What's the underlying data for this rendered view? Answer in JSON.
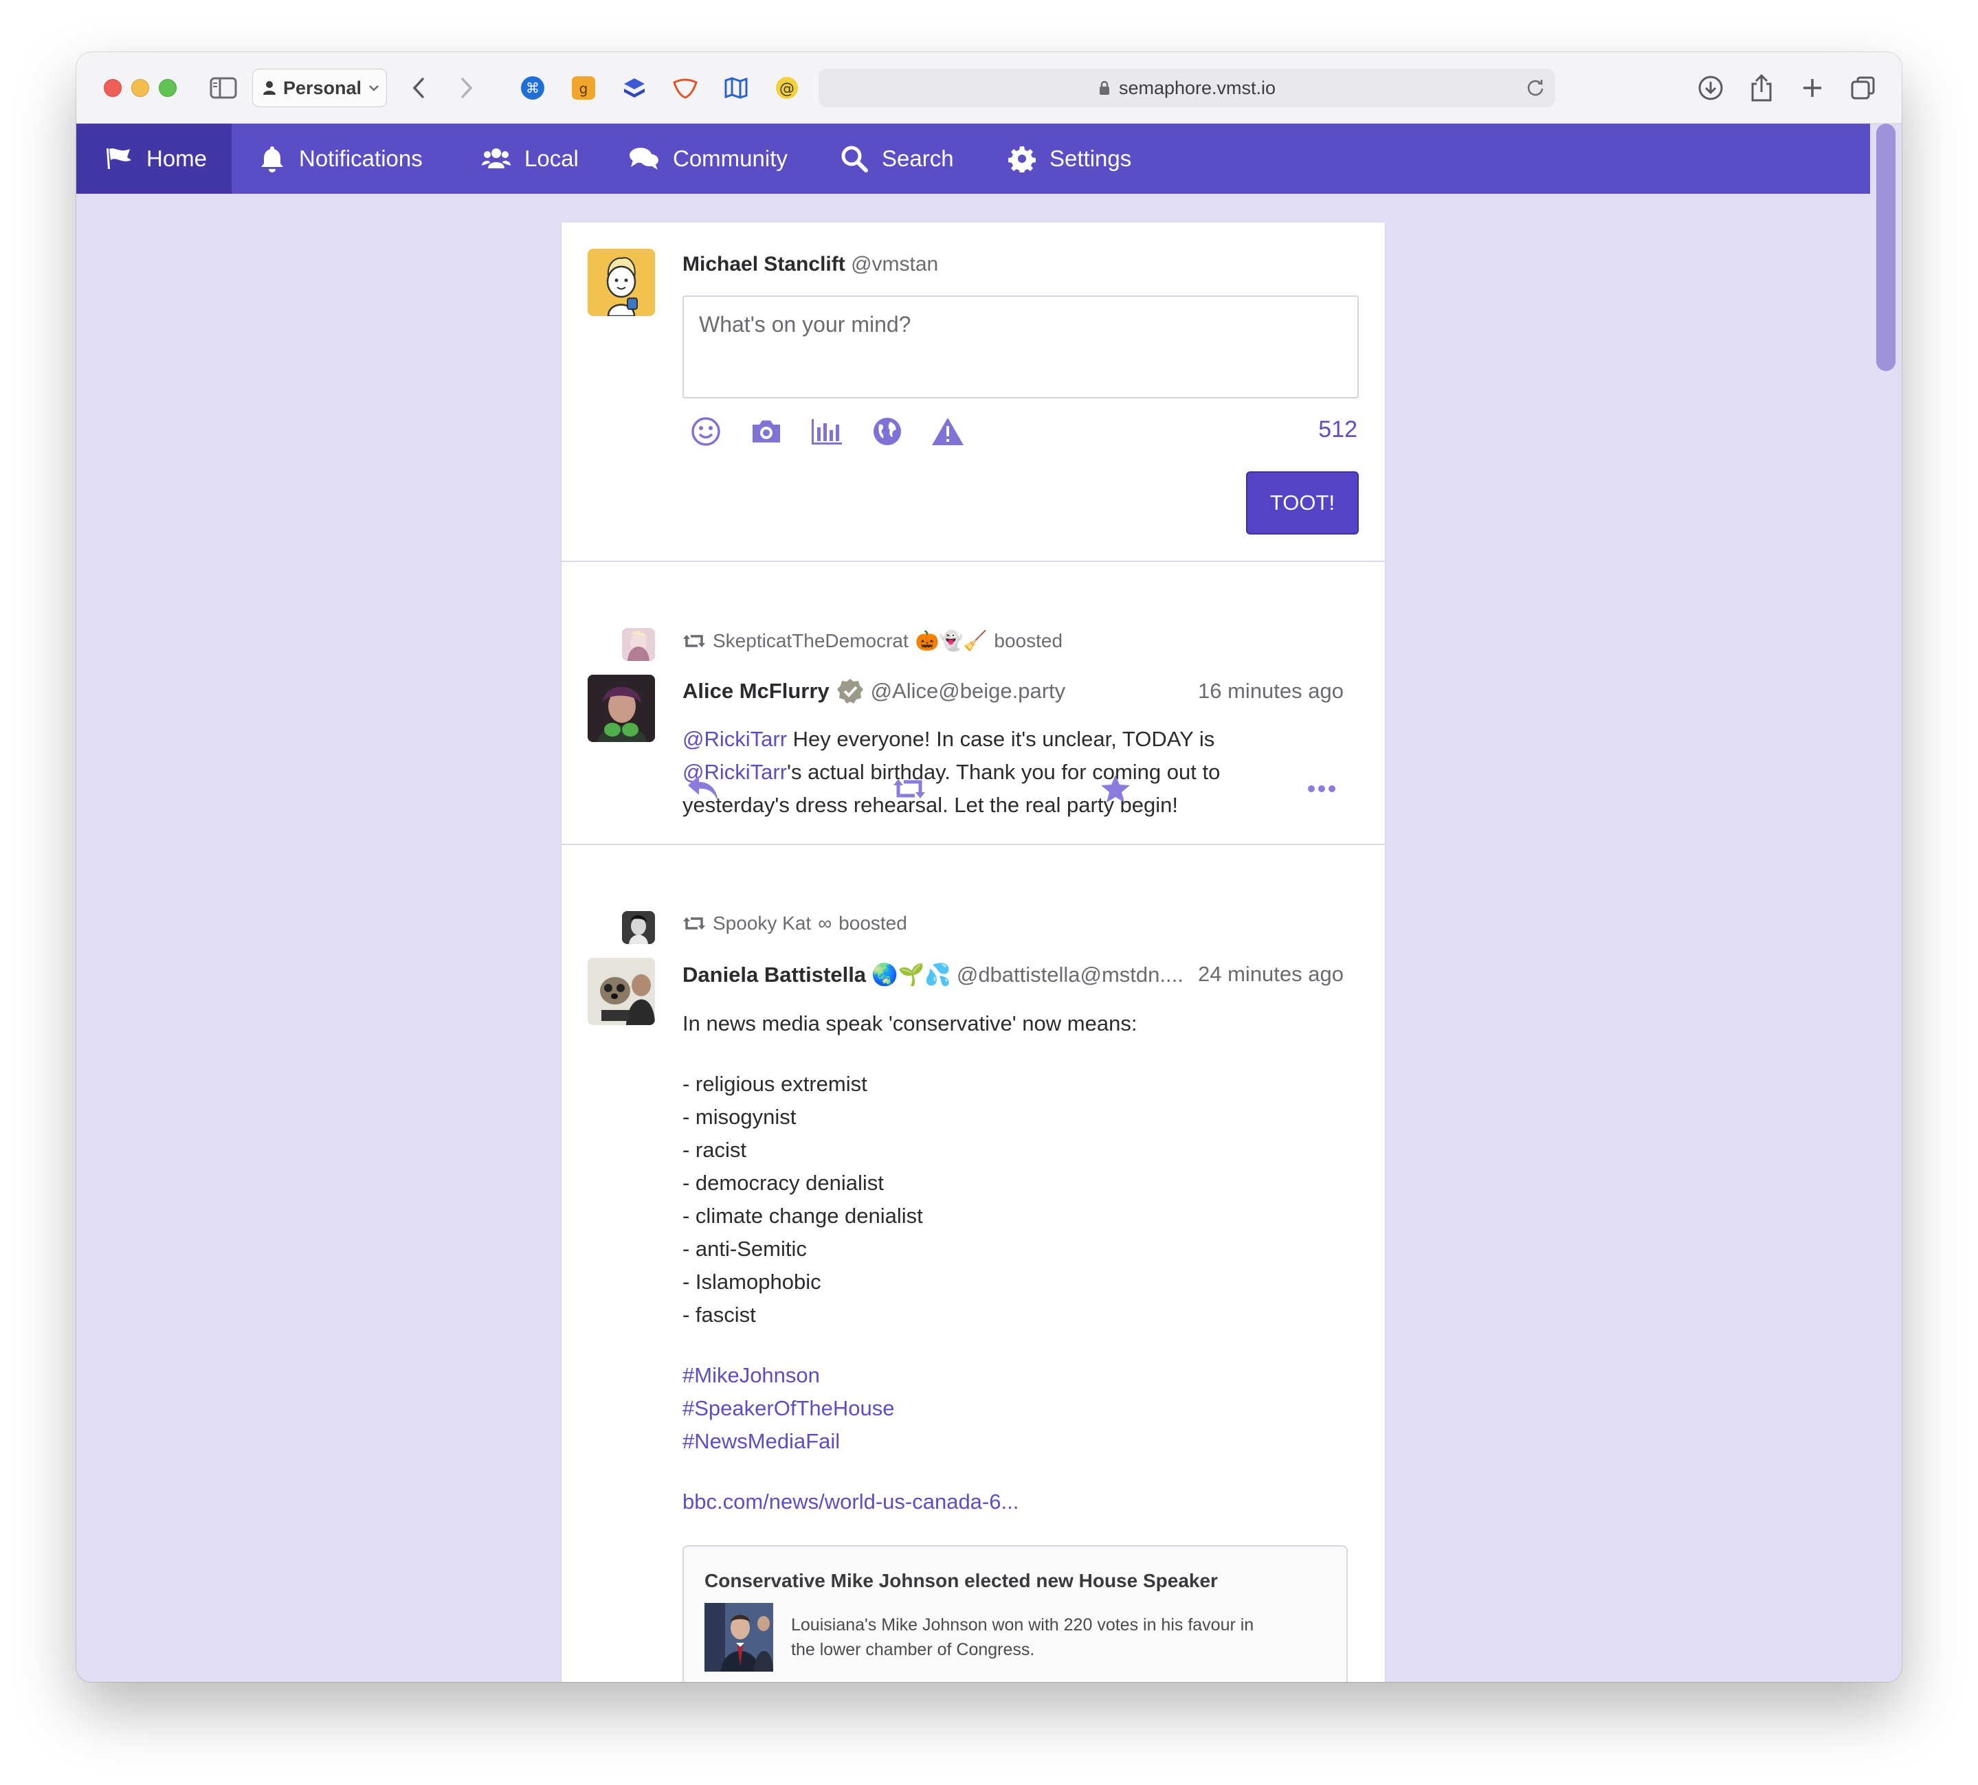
{
  "browser": {
    "profile": "Personal",
    "url": "semaphore.vmst.io"
  },
  "nav": {
    "items": [
      {
        "label": "Home",
        "icon": "flag-icon"
      },
      {
        "label": "Notifications",
        "icon": "bell-icon"
      },
      {
        "label": "Local",
        "icon": "users-icon"
      },
      {
        "label": "Community",
        "icon": "comments-icon"
      },
      {
        "label": "Search",
        "icon": "search-icon"
      },
      {
        "label": "Settings",
        "icon": "gear-icon"
      }
    ],
    "active": "Home"
  },
  "compose": {
    "display_name": "Michael Stanclift",
    "handle": "@vmstan",
    "placeholder": "What's on your mind?",
    "char_count": "512",
    "submit_label": "TOOT!",
    "tools": [
      "emoji-icon",
      "camera-icon",
      "poll-icon",
      "globe-icon",
      "warning-icon"
    ]
  },
  "posts": [
    {
      "booster": "SkepticatTheDemocrat",
      "booster_emoji": "🎃👻🧹",
      "boosted_label": "boosted",
      "display_name": "Alice McFlurry",
      "verified": true,
      "handle": "@Alice@beige.party",
      "time": "16 minutes ago",
      "mention1": "@RickiTarr",
      "text1": " Hey everyone! In case it's unclear, TODAY is",
      "mention2": "@RickiTarr",
      "text2": "'s actual birthday. Thank you for coming out to",
      "text3": "yesterday's dress rehearsal. Let the real party begin!"
    },
    {
      "booster": "Spooky Kat",
      "booster_emoji": "∞",
      "boosted_label": "boosted",
      "display_name": "Daniela Battistella",
      "name_emoji": "🌏🌱💦",
      "handle": "@dbattistella@mstdn....",
      "time": "24 minutes ago",
      "intro": "In news media speak 'conservative' now means:",
      "list": [
        "- religious extremist",
        "- misogynist",
        "- racist",
        "- democracy denialist",
        "- climate change denialist",
        "- anti-Semitic",
        "- Islamophobic",
        "- fascist"
      ],
      "hashtags": [
        "#MikeJohnson",
        "#SpeakerOfTheHouse",
        "#NewsMediaFail"
      ],
      "link": "bbc.com/news/world-us-canada-6...",
      "card": {
        "title": "Conservative Mike Johnson elected new House Speaker",
        "description_line1": "Louisiana's Mike Johnson won with 220 votes in his favour in",
        "description_line2": "the lower chamber of Congress."
      }
    }
  ]
}
